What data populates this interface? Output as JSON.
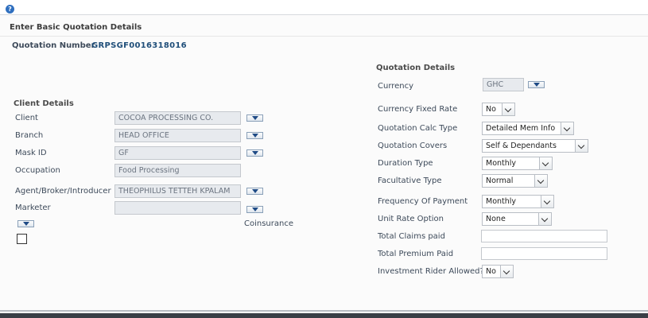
{
  "help_symbol": "?",
  "title": "Enter Basic Quotation Details",
  "quotation_number": {
    "label": "Quotation Number",
    "value": "GRPSGF0016318016"
  },
  "client_details": {
    "title": "Client Details",
    "client": {
      "label": "Client",
      "value": "COCOA PROCESSING CO."
    },
    "branch": {
      "label": "Branch",
      "value": "HEAD OFFICE"
    },
    "mask_id": {
      "label": "Mask ID",
      "value": "GF"
    },
    "occupation": {
      "label": "Occupation",
      "value": "Food Processing"
    },
    "agent": {
      "label": "Agent/Broker/Introducer",
      "value": "THEOPHILUS TETTEH KPALAM"
    },
    "marketer": {
      "label": "Marketer",
      "value": ""
    },
    "coinsurance": {
      "label": "Coinsurance"
    }
  },
  "quotation_details": {
    "title": "Quotation Details",
    "currency": {
      "label": "Currency",
      "value": "GHC"
    },
    "currency_fixed_rate": {
      "label": "Currency Fixed Rate",
      "value": "No"
    },
    "calc_type": {
      "label": "Quotation Calc Type",
      "value": "Detailed Mem Info"
    },
    "covers": {
      "label": "Quotation Covers",
      "value": "Self & Dependants"
    },
    "duration_type": {
      "label": "Duration Type",
      "value": "Monthly"
    },
    "facultative_type": {
      "label": "Facultative Type",
      "value": "Normal"
    },
    "frequency": {
      "label": "Frequency Of Payment",
      "value": "Monthly"
    },
    "unit_rate": {
      "label": "Unit Rate Option",
      "value": "None"
    },
    "total_claims": {
      "label": "Total Claims paid",
      "value": ""
    },
    "total_premium": {
      "label": "Total Premium Paid",
      "value": ""
    },
    "investment_rider": {
      "label": "Investment Rider Allowed?",
      "value": "No"
    }
  }
}
